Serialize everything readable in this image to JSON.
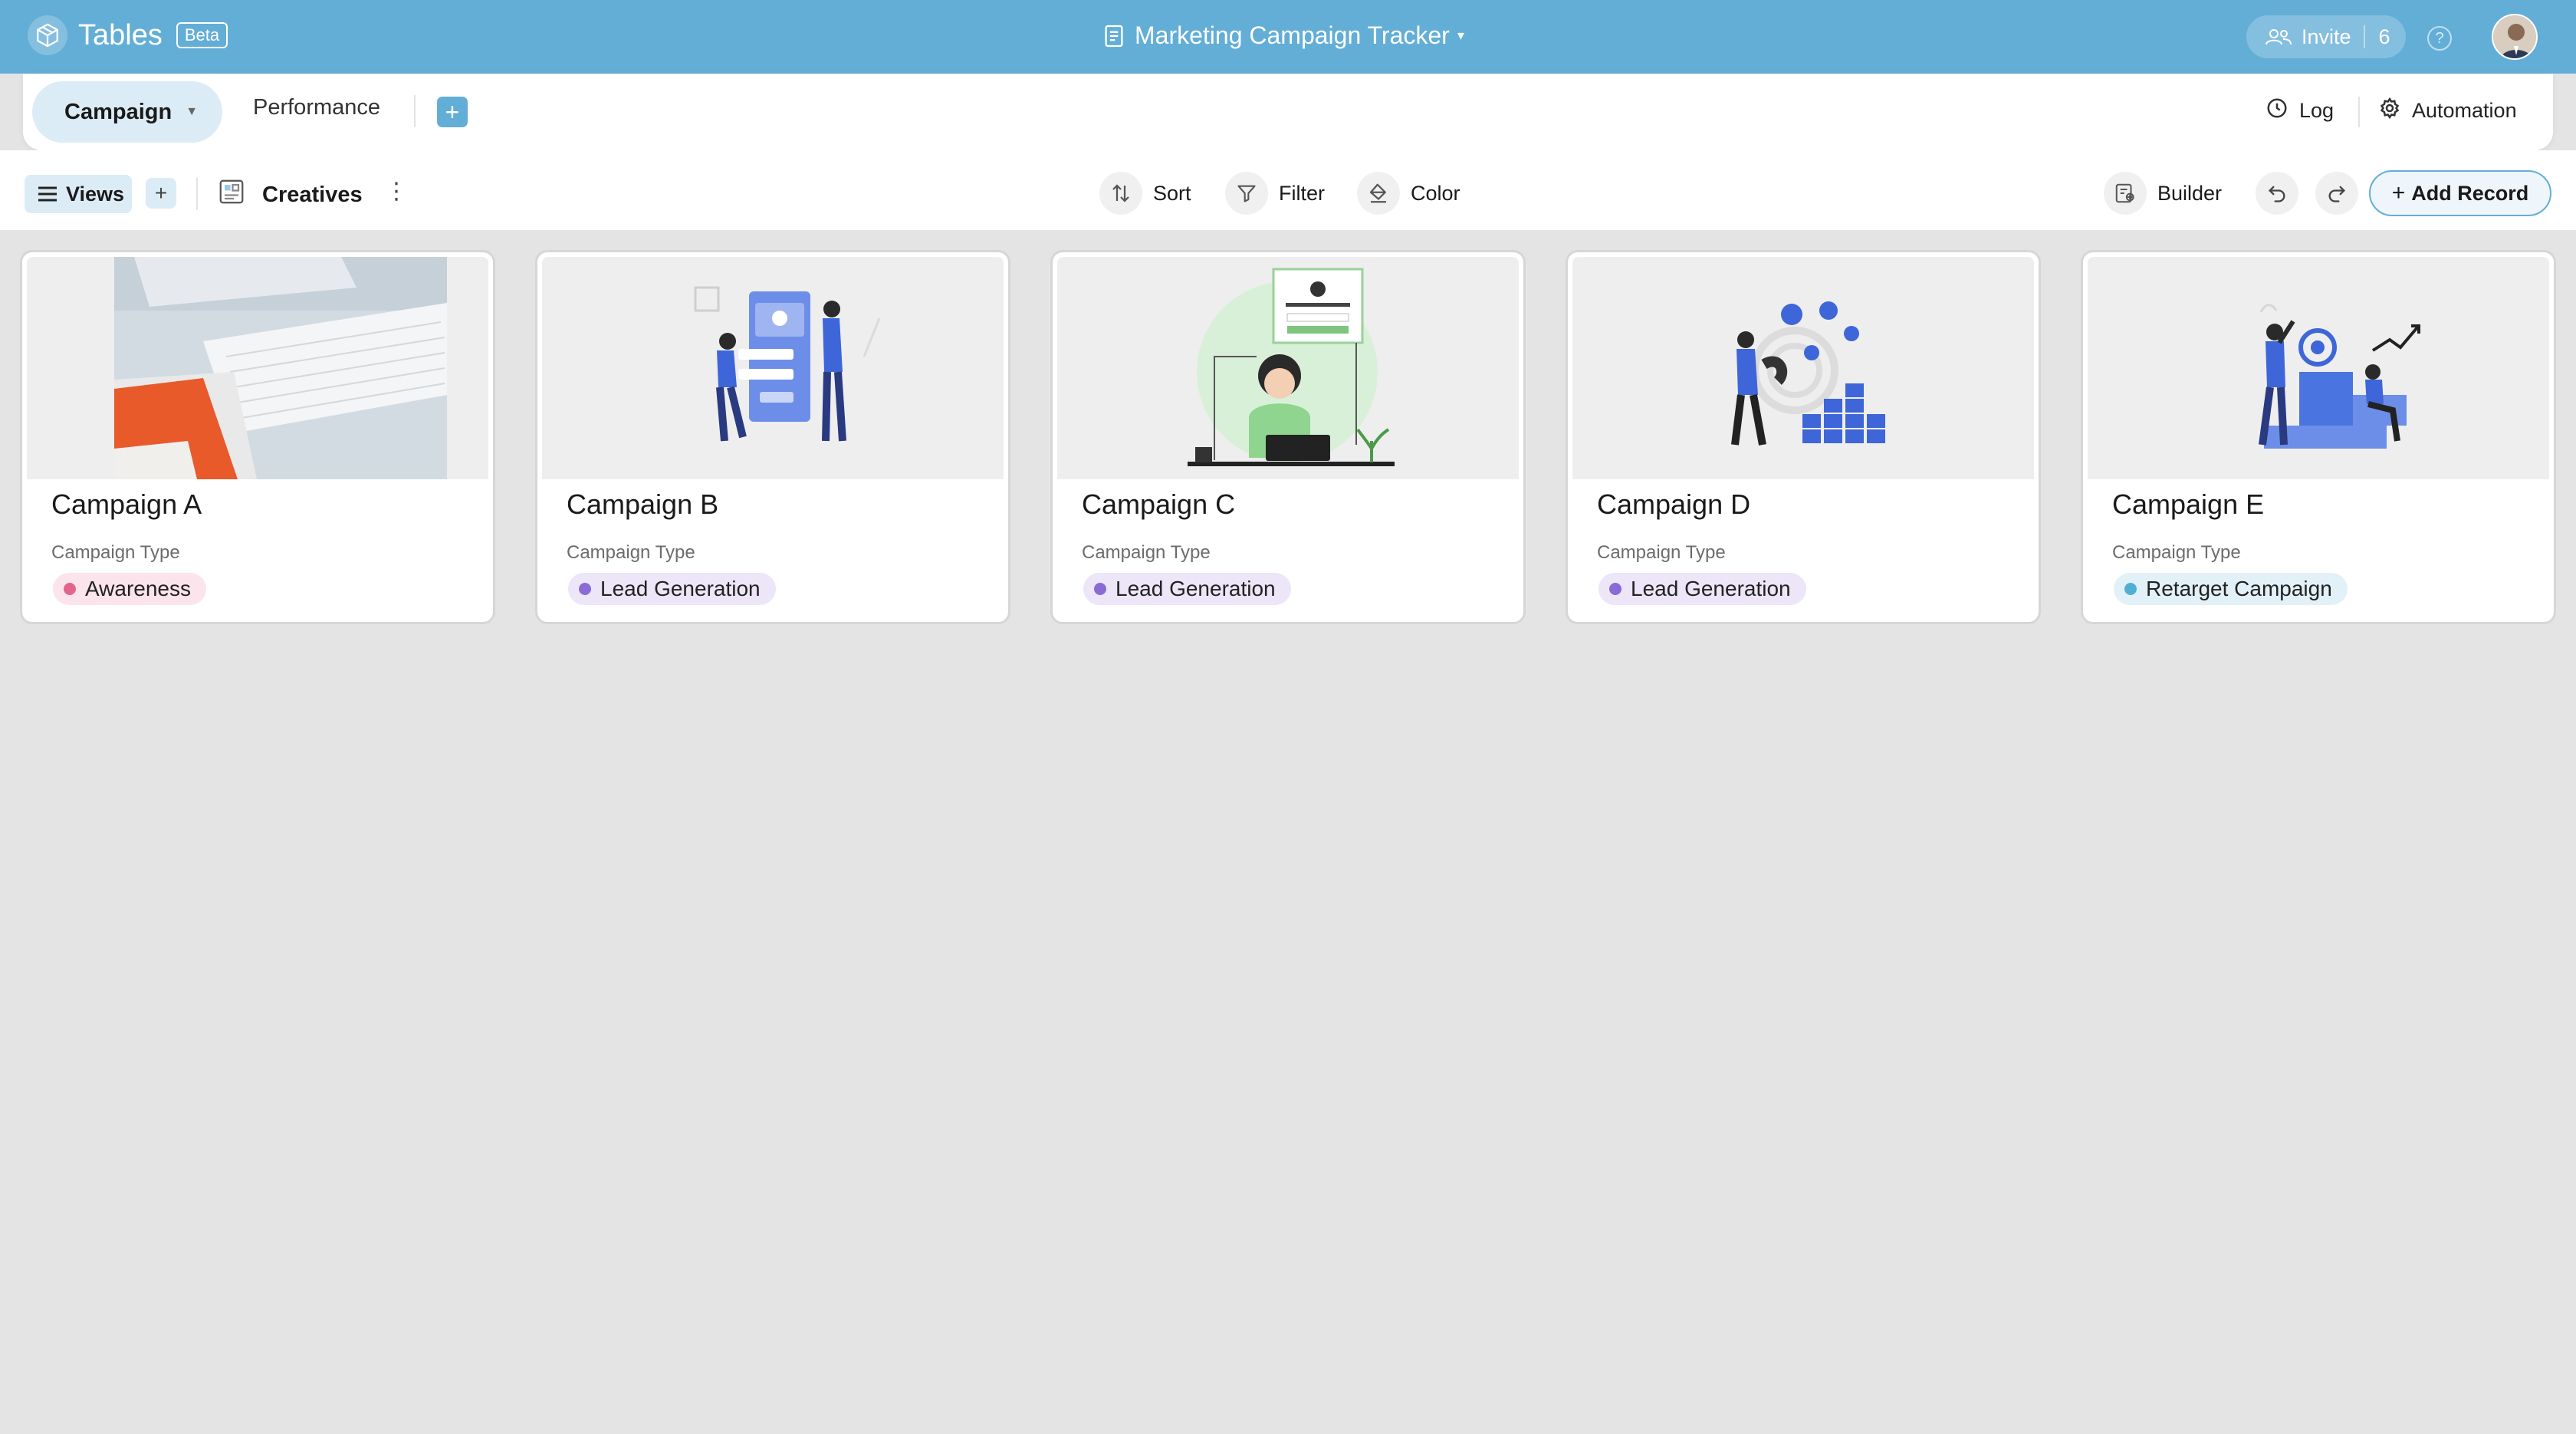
{
  "app": {
    "name": "Tables",
    "badge": "Beta"
  },
  "document": {
    "title": "Marketing Campaign Tracker"
  },
  "header": {
    "invite_label": "Invite",
    "invite_count": "6",
    "help_symbol": "?"
  },
  "tabs": [
    {
      "label": "Campaign",
      "active": true
    },
    {
      "label": "Performance",
      "active": false
    }
  ],
  "tabbar_actions": {
    "log_label": "Log",
    "automation_label": "Automation"
  },
  "toolbar": {
    "views_label": "Views",
    "view_name": "Creatives",
    "sort_label": "Sort",
    "filter_label": "Filter",
    "color_label": "Color",
    "builder_label": "Builder",
    "add_record_label": "Add Record"
  },
  "cards": [
    {
      "title": "Campaign A",
      "field_label": "Campaign Type",
      "type": "Awareness",
      "pill_bg": "#fce4ec",
      "dot": "#e5648c",
      "image": "brand-identity-photo"
    },
    {
      "title": "Campaign B",
      "field_label": "Campaign Type",
      "type": "Lead Generation",
      "pill_bg": "#ece6f8",
      "dot": "#8a6ad4",
      "image": "signup-form-illustration"
    },
    {
      "title": "Campaign C",
      "field_label": "Campaign Type",
      "type": "Lead Generation",
      "pill_bg": "#ece6f8",
      "dot": "#8a6ad4",
      "image": "authenticate-account-illustration"
    },
    {
      "title": "Campaign D",
      "field_label": "Campaign Type",
      "type": "Lead Generation",
      "pill_bg": "#ece6f8",
      "dot": "#8a6ad4",
      "image": "magnet-coins-illustration"
    },
    {
      "title": "Campaign E",
      "field_label": "Campaign Type",
      "type": "Retarget Campaign",
      "pill_bg": "#e2f1f7",
      "dot": "#4fb0d4",
      "image": "target-goals-illustration"
    }
  ],
  "colors": {
    "accent": "#63aed6",
    "background": "#e4e4e4",
    "tab_active": "#dcecf6"
  }
}
